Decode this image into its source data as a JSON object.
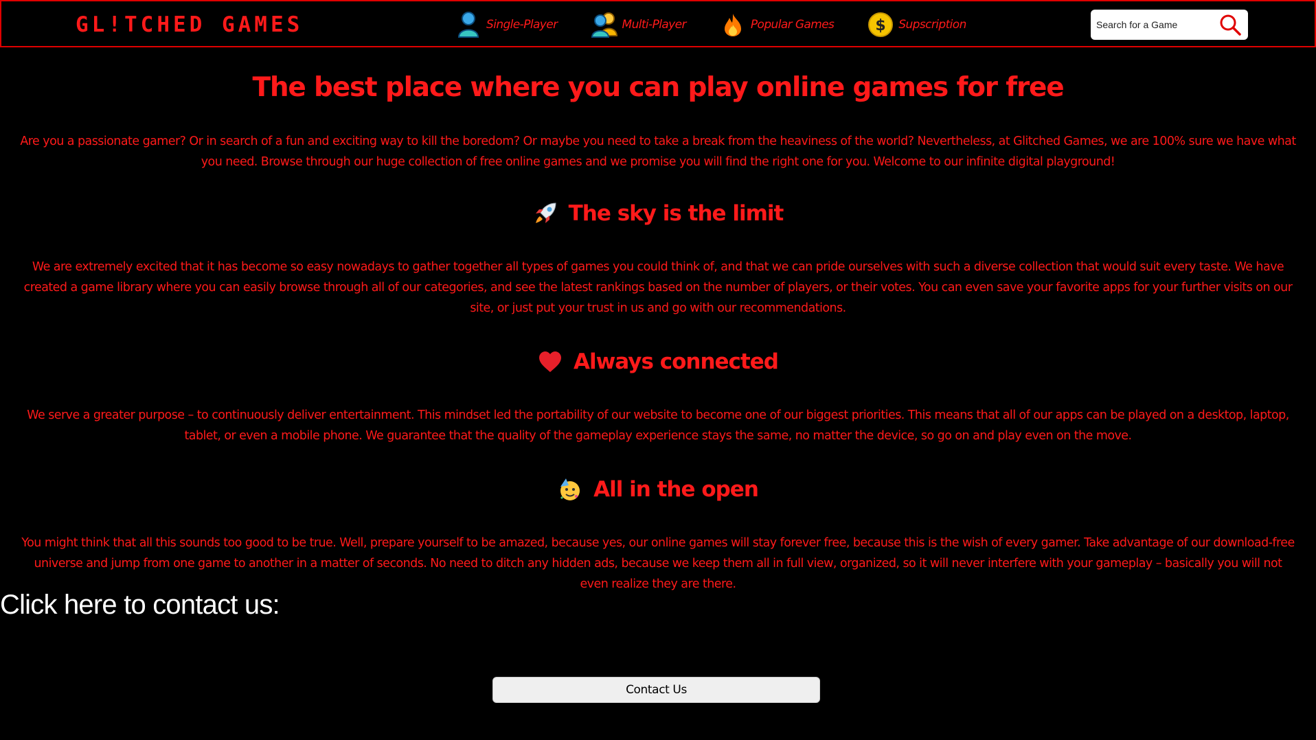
{
  "header": {
    "logo": "GL!TCHED GAMES",
    "nav": [
      {
        "label": "Single-Player",
        "icon": "single-player-icon"
      },
      {
        "label": "Multi-Player",
        "icon": "multi-player-icon"
      },
      {
        "label": "Popular Games",
        "icon": "fire-icon"
      },
      {
        "label": "Supscription",
        "icon": "dollar-coin-icon"
      }
    ],
    "search_placeholder": "Search for a Game"
  },
  "main": {
    "title": "The best place where you can play online games for free",
    "intro": "Are you a passionate gamer? Or in search of a fun and exciting way to kill the boredom? Or maybe you need to take a break from the heaviness of the world? Nevertheless, at Glitched Games, we are 100% sure we have what you need. Browse through our huge collection of free online games and we promise you will find the right one for you. Welcome to our infinite digital playground!",
    "sections": [
      {
        "icon": "rocket-icon",
        "heading": "The sky is the limit",
        "text": "We are extremely excited that it has become so easy nowadays to gather together all types of games you could think of, and that we can pride ourselves with such a diverse collection that would suit every taste. We have created a game library where you can easily browse through all of our categories, and see the latest rankings based on the number of players, or their votes. You can even save your favorite apps for your further visits on our site, or just put your trust in us and go with our recommendations."
      },
      {
        "icon": "heart-icon",
        "heading": "Always connected",
        "text": "We serve a greater purpose – to continuously deliver entertainment. This mindset led the portability of our website to become one of our biggest priorities. This means that all of our apps can be played on a desktop, laptop, tablet, or even a mobile phone. We guarantee that the quality of the gameplay experience stays the same, no matter the device, so go on and play even on the move."
      },
      {
        "icon": "party-face-icon",
        "heading": "All in the open",
        "text": "You might think that all this sounds too good to be true. Well, prepare yourself to be amazed, because yes, our online games will stay forever free, because this is the wish of every gamer. Take advantage of our download-free universe and jump from one game to another in a matter of seconds. No need to ditch any hidden ads, because we keep them all in full view, organized, so it will never interfere with your gameplay – basically you will not even realize they are there."
      }
    ],
    "contact_title": "Click here to contact us:",
    "contact_button": "Contact Us"
  },
  "colors": {
    "accent": "#ff1a1a",
    "background": "#000000"
  }
}
